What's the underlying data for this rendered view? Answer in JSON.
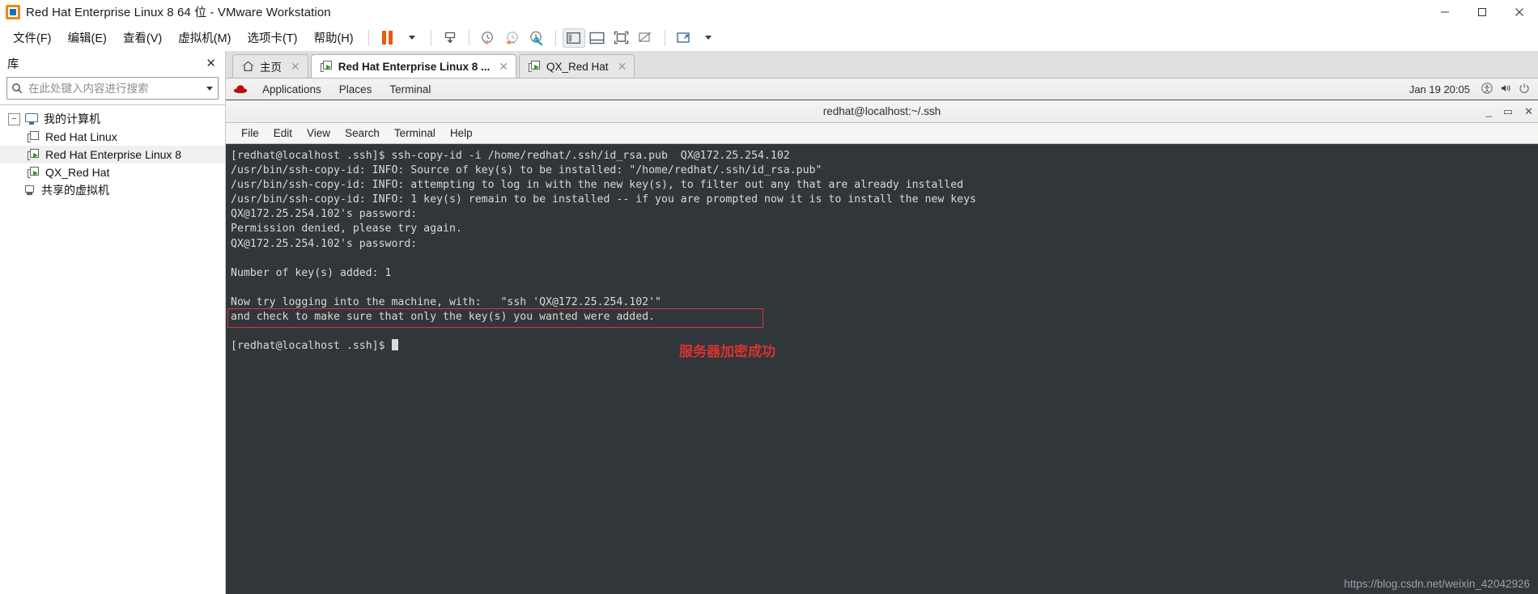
{
  "window": {
    "title": "Red Hat Enterprise Linux 8 64 位 - VMware Workstation",
    "minimize": "—",
    "maximize": "❐",
    "close": "✕"
  },
  "menubar": {
    "items": [
      {
        "label": "文件(F)",
        "name": "menu-file"
      },
      {
        "label": "编辑(E)",
        "name": "menu-edit"
      },
      {
        "label": "查看(V)",
        "name": "menu-view"
      },
      {
        "label": "虚拟机(M)",
        "name": "menu-vm"
      },
      {
        "label": "选项卡(T)",
        "name": "menu-tabs"
      },
      {
        "label": "帮助(H)",
        "name": "menu-help"
      }
    ],
    "toolbar_icons": [
      "pause-button",
      "dropdown-caret",
      "send-ctrl-alt-del-icon",
      "snapshot-take-icon",
      "snapshot-revert-icon",
      "snapshot-manager-icon",
      "show-library-icon",
      "show-thumbnails-icon",
      "full-screen-icon",
      "unity-mode-icon",
      "stretch-caret"
    ]
  },
  "library": {
    "title": "库",
    "close_label": "✕",
    "search": {
      "placeholder": "在此处键入内容进行搜索",
      "value": "",
      "icon": "search-icon",
      "dropdown_icon": "chevron-down-icon"
    },
    "tree": [
      {
        "label": "我的计算机",
        "icon": "monitor-icon",
        "level": 0,
        "expander": "−",
        "selected": false
      },
      {
        "label": "Red Hat Linux",
        "icon": "vm-stopped-icon",
        "level": 1,
        "selected": false
      },
      {
        "label": "Red Hat Enterprise Linux 8",
        "icon": "vm-running-icon",
        "level": 1,
        "selected": true
      },
      {
        "label": "QX_Red Hat",
        "icon": "vm-running-icon",
        "level": 1,
        "selected": false
      },
      {
        "label": "共享的虚拟机",
        "icon": "shared-vms-icon",
        "level": 0,
        "selected": false
      }
    ]
  },
  "tabs": [
    {
      "label": "主页",
      "icon": "home-icon",
      "active": false,
      "close": "✕"
    },
    {
      "label": "Red Hat Enterprise Linux 8 ...",
      "icon": "vm-running-icon",
      "active": true,
      "close": "✕"
    },
    {
      "label": "QX_Red Hat",
      "icon": "vm-running-icon",
      "active": false,
      "close": "✕"
    }
  ],
  "guest": {
    "gnome_bar": {
      "logo": "red-hat-logo-icon",
      "menus": [
        "Applications",
        "Places",
        "Terminal"
      ],
      "clock": "Jan 19 20:05",
      "tray": [
        "accessibility-icon",
        "volume-icon",
        "power-icon"
      ]
    },
    "terminal": {
      "title": "redhat@localhost:~/.ssh",
      "window_controls": {
        "minimize": "_",
        "maximize": "▭",
        "close": "✕"
      },
      "menu": [
        "File",
        "Edit",
        "View",
        "Search",
        "Terminal",
        "Help"
      ],
      "lines": [
        "[redhat@localhost .ssh]$ ssh-copy-id -i /home/redhat/.ssh/id_rsa.pub  QX@172.25.254.102",
        "/usr/bin/ssh-copy-id: INFO: Source of key(s) to be installed: \"/home/redhat/.ssh/id_rsa.pub\"",
        "/usr/bin/ssh-copy-id: INFO: attempting to log in with the new key(s), to filter out any that are already installed",
        "/usr/bin/ssh-copy-id: INFO: 1 key(s) remain to be installed -- if you are prompted now it is to install the new keys",
        "QX@172.25.254.102's password:",
        "Permission denied, please try again.",
        "QX@172.25.254.102's password:",
        "",
        "Number of key(s) added: 1",
        "",
        "Now try logging into the machine, with:   \"ssh 'QX@172.25.254.102'\"",
        "and check to make sure that only the key(s) you wanted were added.",
        "",
        "[redhat@localhost .ssh]$ "
      ],
      "prompt_cursor": true
    },
    "annotation": {
      "text": "服务器加密成功",
      "color": "#d8332e",
      "highlight_box_color": "#d33a35"
    }
  },
  "watermark": "https://blog.csdn.net/weixin_42042926"
}
